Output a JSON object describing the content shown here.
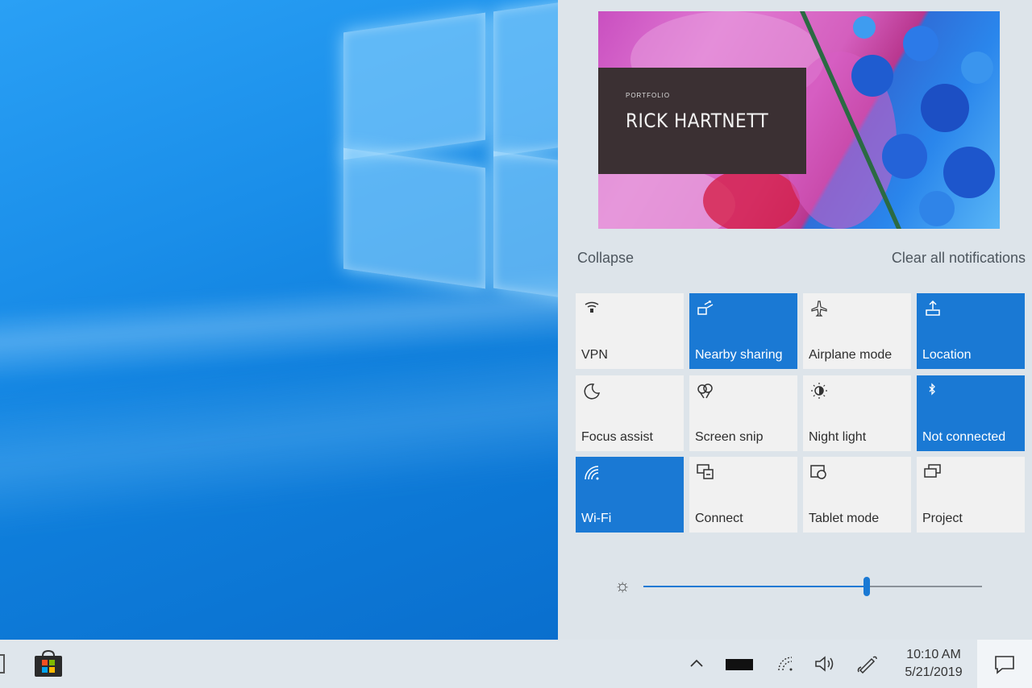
{
  "desktop": {},
  "notification": {
    "small_text": "PORTFOLIO",
    "name": "RICK HARTNETT"
  },
  "action_center": {
    "collapse_label": "Collapse",
    "clear_all_label": "Clear all notifications",
    "accent_color": "#1a79d4",
    "tiles": [
      {
        "label": "VPN",
        "icon": "vpn-icon",
        "on": false
      },
      {
        "label": "Nearby sharing",
        "icon": "nearby-sharing-icon",
        "on": true
      },
      {
        "label": "Airplane mode",
        "icon": "airplane-icon",
        "on": false
      },
      {
        "label": "Location",
        "icon": "location-icon",
        "on": true
      },
      {
        "label": "Focus assist",
        "icon": "moon-icon",
        "on": false
      },
      {
        "label": "Screen snip",
        "icon": "screen-snip-icon",
        "on": false
      },
      {
        "label": "Night light",
        "icon": "night-light-icon",
        "on": false
      },
      {
        "label": "Not connected",
        "icon": "bluetooth-icon",
        "on": true
      },
      {
        "label": "Wi-Fi",
        "icon": "wifi-icon",
        "on": true
      },
      {
        "label": "Connect",
        "icon": "connect-icon",
        "on": false
      },
      {
        "label": "Tablet mode",
        "icon": "tablet-mode-icon",
        "on": false
      },
      {
        "label": "Project",
        "icon": "project-icon",
        "on": false
      }
    ],
    "brightness": {
      "icon": "sun-icon",
      "level": 0.66
    }
  },
  "taskbar": {
    "store_icon": "microsoft-store-icon",
    "tray": {
      "chevron_icon": "chevron-up-icon",
      "battery_icon": "battery-icon",
      "network_icon": "network-icon",
      "volume_icon": "volume-icon",
      "pen_icon": "pen-icon"
    },
    "time": "10:10 AM",
    "date": "5/21/2019",
    "action_center_icon": "action-center-icon"
  }
}
